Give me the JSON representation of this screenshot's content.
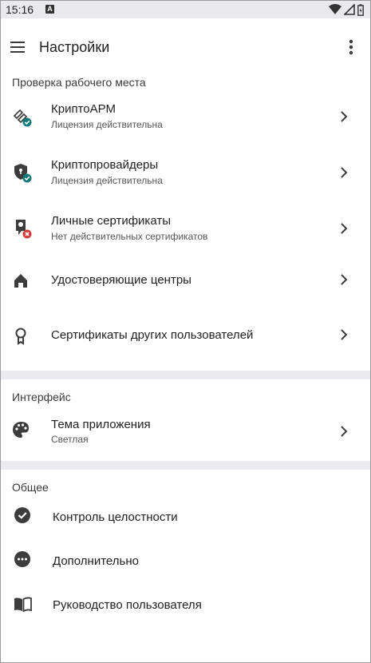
{
  "status_bar": {
    "time": "15:16",
    "notification_letter": "A"
  },
  "app_bar": {
    "title": "Настройки"
  },
  "sections": {
    "workplace": {
      "title": "Проверка рабочего места",
      "items": [
        {
          "title": "КриптоАРМ",
          "subtitle": "Лицензия действительна"
        },
        {
          "title": "Криптопровайдеры",
          "subtitle": "Лицензия действительна"
        },
        {
          "title": "Личные сертификаты",
          "subtitle": "Нет действительных сертификатов"
        },
        {
          "title": "Удостоверяющие центры"
        },
        {
          "title": "Сертификаты других пользователей"
        }
      ]
    },
    "interface": {
      "title": "Интерфейс",
      "items": [
        {
          "title": "Тема приложения",
          "subtitle": "Светлая"
        }
      ]
    },
    "general": {
      "title": "Общее",
      "items": [
        {
          "title": "Контроль целостности"
        },
        {
          "title": "Дополнительно"
        },
        {
          "title": "Руководство пользователя"
        }
      ]
    }
  },
  "colors": {
    "ok_badge": "#0f7a7a",
    "error_badge": "#d23c3c",
    "icon": "#3c3c3c",
    "band": "#ebebef"
  }
}
